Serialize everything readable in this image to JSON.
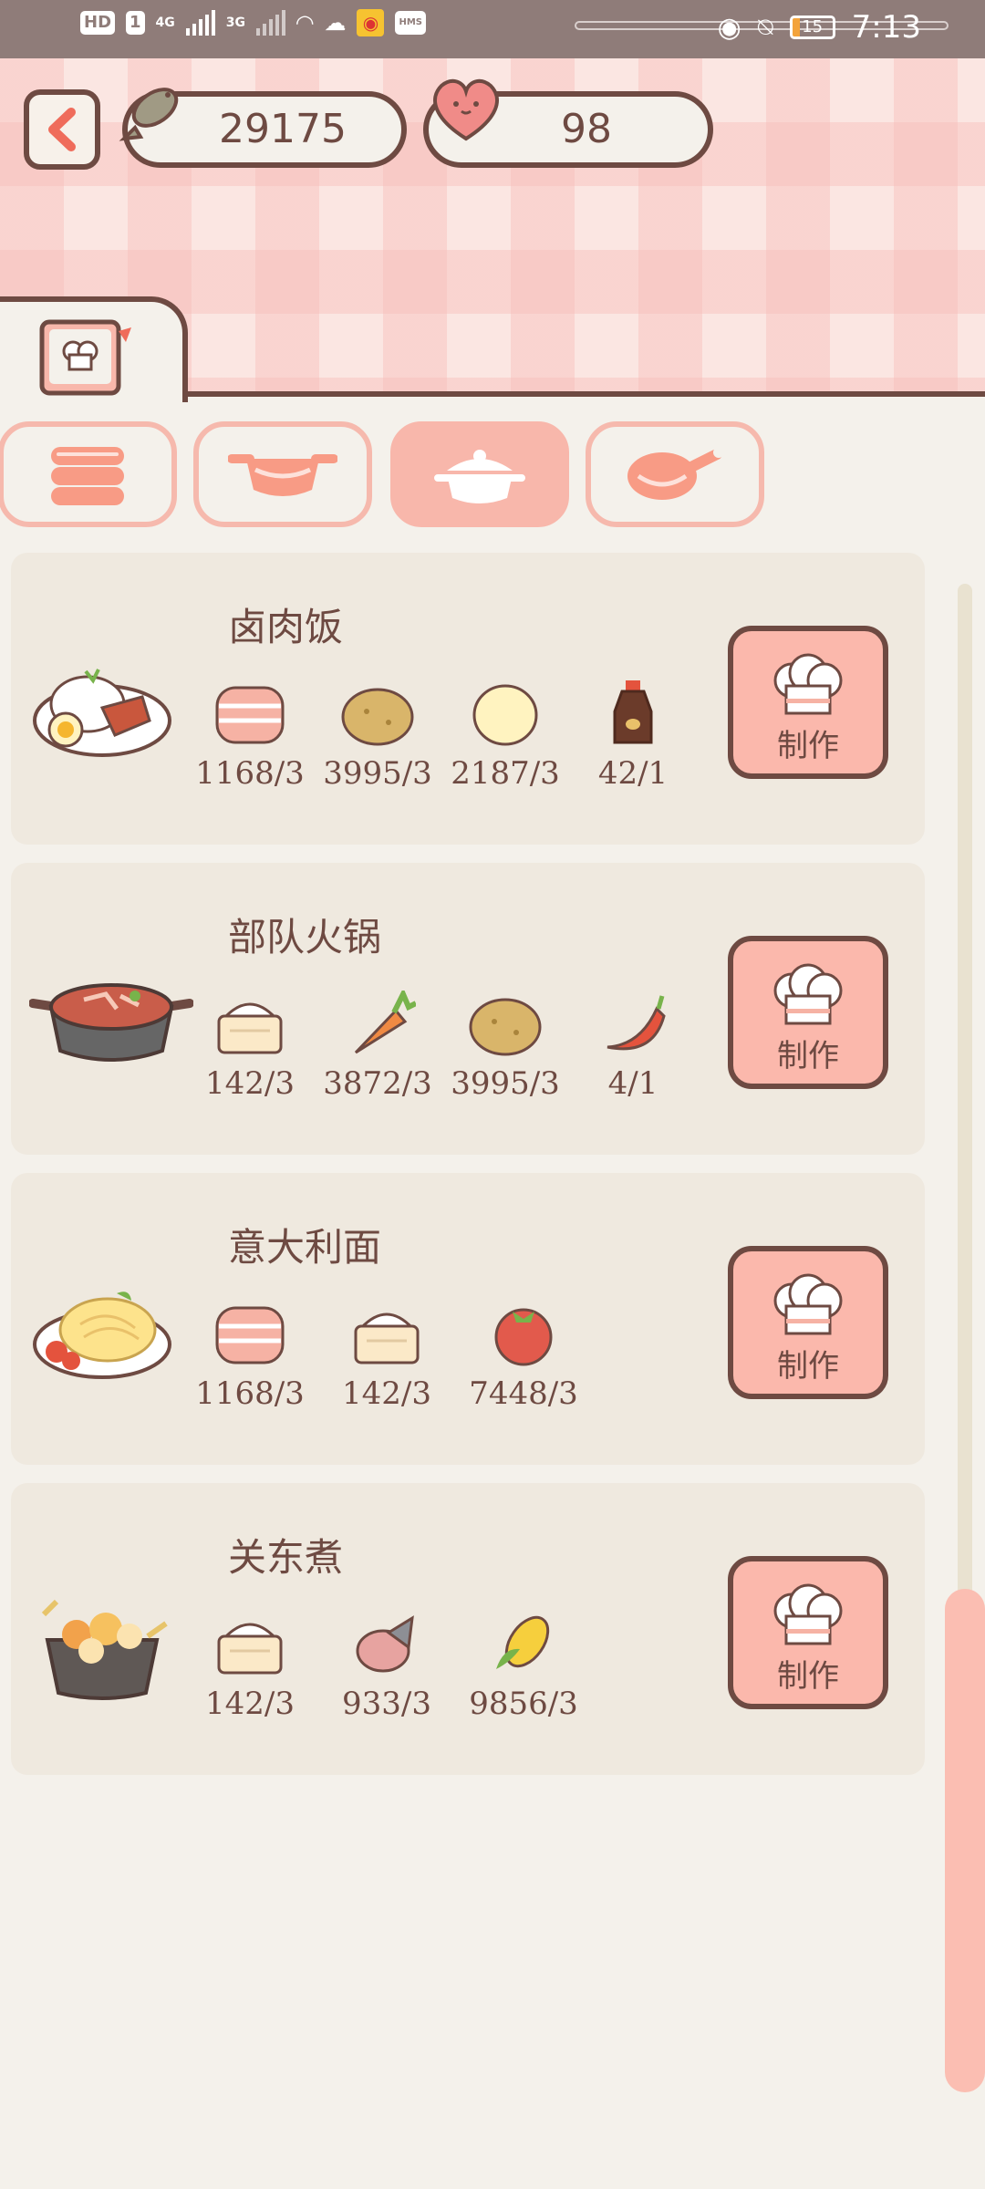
{
  "status_bar": {
    "left_badges": [
      "HD",
      "1",
      "4G",
      "3G",
      "HMS"
    ],
    "time": "7:13",
    "battery": "15"
  },
  "header": {
    "fish_count": "29175",
    "heart_count": "98"
  },
  "categories": [
    {
      "icon": "stacked-dish-icon",
      "active": false
    },
    {
      "icon": "pot-icon",
      "active": false
    },
    {
      "icon": "casserole-icon",
      "active": true
    },
    {
      "icon": "frying-pan-icon",
      "active": false
    }
  ],
  "recipes": [
    {
      "name": "卤肉饭",
      "dish_icon": "braised-pork-rice-icon",
      "ingredients": [
        {
          "icon": "bacon-icon",
          "qty": "1168/3"
        },
        {
          "icon": "potato-icon",
          "qty": "3995/3"
        },
        {
          "icon": "egg-icon",
          "qty": "2187/3"
        },
        {
          "icon": "soy-sauce-icon",
          "qty": "42/1"
        }
      ],
      "button": "制作"
    },
    {
      "name": "部队火锅",
      "dish_icon": "army-hotpot-icon",
      "ingredients": [
        {
          "icon": "rice-icon",
          "qty": "142/3"
        },
        {
          "icon": "carrot-icon",
          "qty": "3872/3"
        },
        {
          "icon": "potato-icon",
          "qty": "3995/3"
        },
        {
          "icon": "chili-icon",
          "qty": "4/1"
        }
      ],
      "button": "制作"
    },
    {
      "name": "意大利面",
      "dish_icon": "spaghetti-icon",
      "ingredients": [
        {
          "icon": "bacon-icon",
          "qty": "1168/3"
        },
        {
          "icon": "rice-icon",
          "qty": "142/3"
        },
        {
          "icon": "tomato-icon",
          "qty": "7448/3"
        }
      ],
      "button": "制作"
    },
    {
      "name": "关东煮",
      "dish_icon": "oden-icon",
      "ingredients": [
        {
          "icon": "rice-icon",
          "qty": "142/3"
        },
        {
          "icon": "fish-icon",
          "qty": "933/3"
        },
        {
          "icon": "corn-icon",
          "qty": "9856/3"
        }
      ],
      "button": "制作"
    }
  ]
}
